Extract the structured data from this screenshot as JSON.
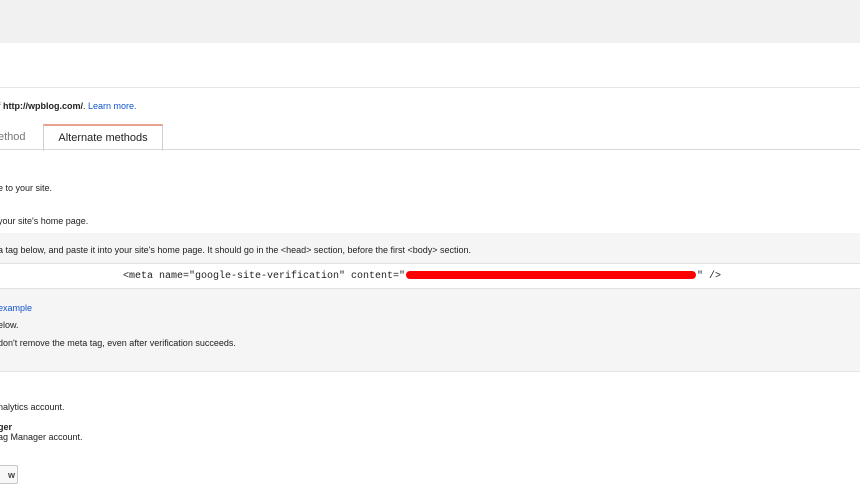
{
  "intro": {
    "prefix": "f ",
    "site_url": "http://wpblog.com/",
    "suffix": ". ",
    "learn_more": "Learn more."
  },
  "tabs": {
    "recommended_partial": "ethod",
    "alternate": "Alternate methods"
  },
  "steps": {
    "step1": "e to your site.",
    "step2": "your site's home page.",
    "instruction": "a tag below, and paste it into your site's home page. It should go in the <head> section, before the first <body> section.",
    "meta_prefix": "<meta name=\"google-site-verification\" content=\"",
    "meta_suffix": "\" />",
    "example_link": "example",
    "below": "elow.",
    "warning": "don't remove the meta tag, even after verification succeeds."
  },
  "methods": {
    "analytics": "nalytics account.",
    "tag_manager_title": "ger",
    "tag_manager_desc": "ag Manager account."
  },
  "button": {
    "label": "w"
  },
  "colors": {
    "link": "#1155cc",
    "redaction": "#ff0000",
    "tab_accent": "#e8a38e"
  }
}
